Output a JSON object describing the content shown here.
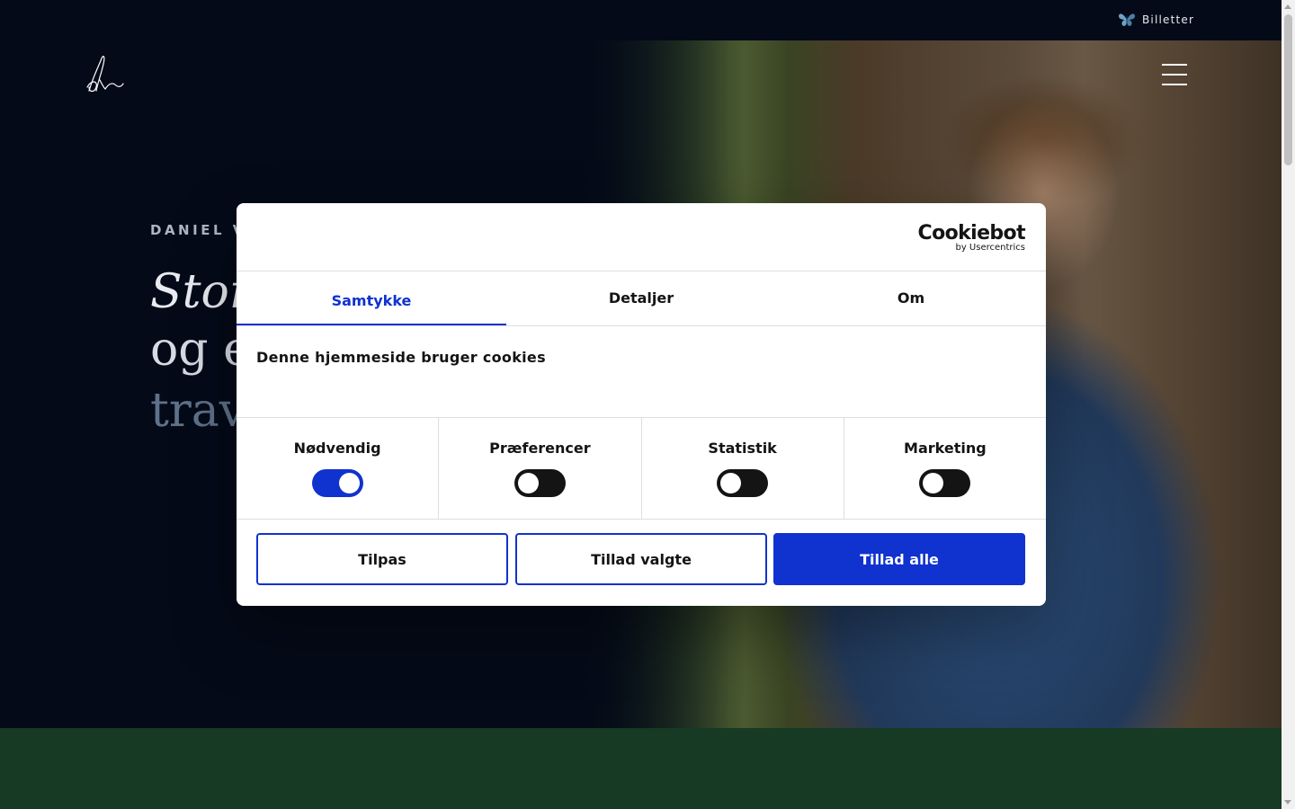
{
  "topbar": {
    "tickets_label": "Billetter",
    "tickets_icon": "butterfly-icon"
  },
  "hero": {
    "eyebrow": "DANIEL VI",
    "heading_line1": "Stor",
    "heading_line2": "og e",
    "heading_line3": "trav"
  },
  "cookie_dialog": {
    "brand_name": "Cookiebot",
    "brand_sub": "by Usercentrics",
    "tabs": [
      {
        "label": "Samtykke",
        "active": true
      },
      {
        "label": "Detaljer",
        "active": false
      },
      {
        "label": "Om",
        "active": false
      }
    ],
    "heading": "Denne hjemmeside bruger cookies",
    "categories": [
      {
        "label": "Nødvendig",
        "enabled": true
      },
      {
        "label": "Præferencer",
        "enabled": false
      },
      {
        "label": "Statistik",
        "enabled": false
      },
      {
        "label": "Marketing",
        "enabled": false
      }
    ],
    "buttons": {
      "customize": "Tilpas",
      "allow_selected": "Tillad valgte",
      "allow_all": "Tillad alle"
    }
  },
  "colors": {
    "accent": "#1032cf",
    "background": "#040a18",
    "green_band": "#163a23"
  }
}
